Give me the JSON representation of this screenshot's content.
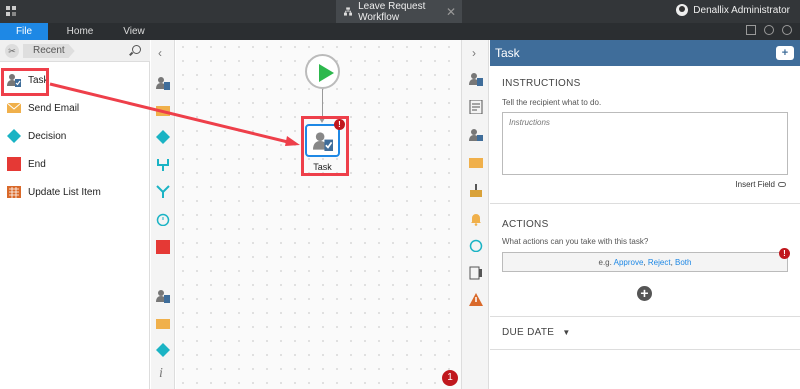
{
  "window": {
    "title": "Leave Request Workflow",
    "user": "Denallix Administrator"
  },
  "ribbon": {
    "tabs": [
      "File",
      "Home",
      "View"
    ]
  },
  "toolbox": {
    "filter_label": "Recent",
    "items": [
      {
        "label": "Task",
        "icon": "task-user-icon"
      },
      {
        "label": "Send Email",
        "icon": "email-icon"
      },
      {
        "label": "Decision",
        "icon": "decision-diamond-icon"
      },
      {
        "label": "End",
        "icon": "end-square-icon"
      },
      {
        "label": "Update List Item",
        "icon": "list-item-icon"
      }
    ]
  },
  "canvas": {
    "task_node_label": "Task",
    "task_node_error": "!",
    "error_count": "1"
  },
  "properties": {
    "title": "Task",
    "instructions_heading": "INSTRUCTIONS",
    "instructions_sub": "Tell the recipient what to do.",
    "instructions_placeholder": "Instructions",
    "insert_field": "Insert Field",
    "actions_heading": "ACTIONS",
    "actions_sub": "What actions can you take with this task?",
    "actions_prefix": "e.g.",
    "actions_examples": [
      "Approve",
      "Reject",
      "Both"
    ],
    "actions_error": "!",
    "due_date_heading": "DUE DATE"
  },
  "colors": {
    "accent": "#1e88e5",
    "highlight": "#ee3f4a",
    "header": "#3f6d9a",
    "error": "#c0171d"
  }
}
